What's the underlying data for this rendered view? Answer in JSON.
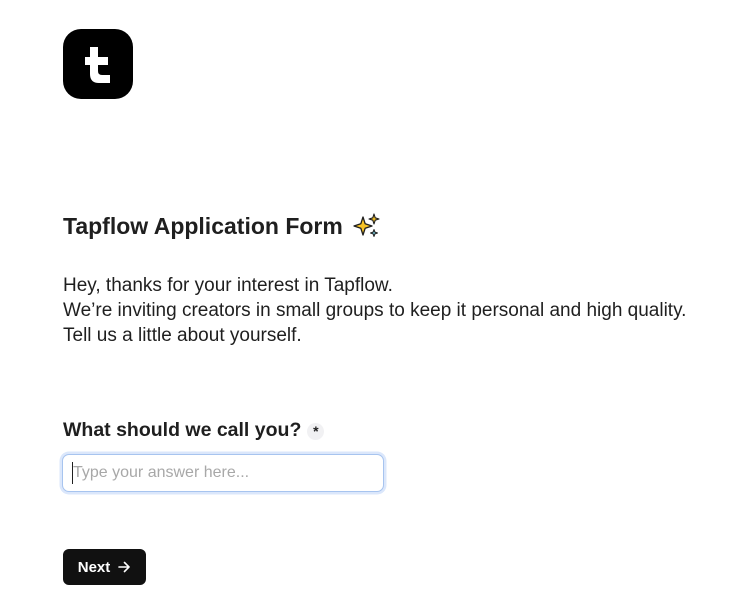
{
  "brand": {
    "logo_icon": "tapflow-logo-icon",
    "logo_color": "#000000"
  },
  "form": {
    "title": "Tapflow Application Form",
    "title_icon": "sparkles-icon",
    "intro_lines": [
      "Hey, thanks for your interest in Tapflow.",
      "We’re inviting creators in small groups to keep it personal and high quality. Tell us a little about yourself."
    ],
    "question": {
      "label": "What should we call you?",
      "required_marker": "*",
      "input_value": "",
      "input_placeholder": "Type your answer here..."
    },
    "next_button": {
      "label": "Next",
      "icon": "arrow-right-icon"
    }
  },
  "colors": {
    "accent_focus": "#a7c4ef",
    "button_bg": "#111111",
    "text": "#1f1f1f"
  }
}
